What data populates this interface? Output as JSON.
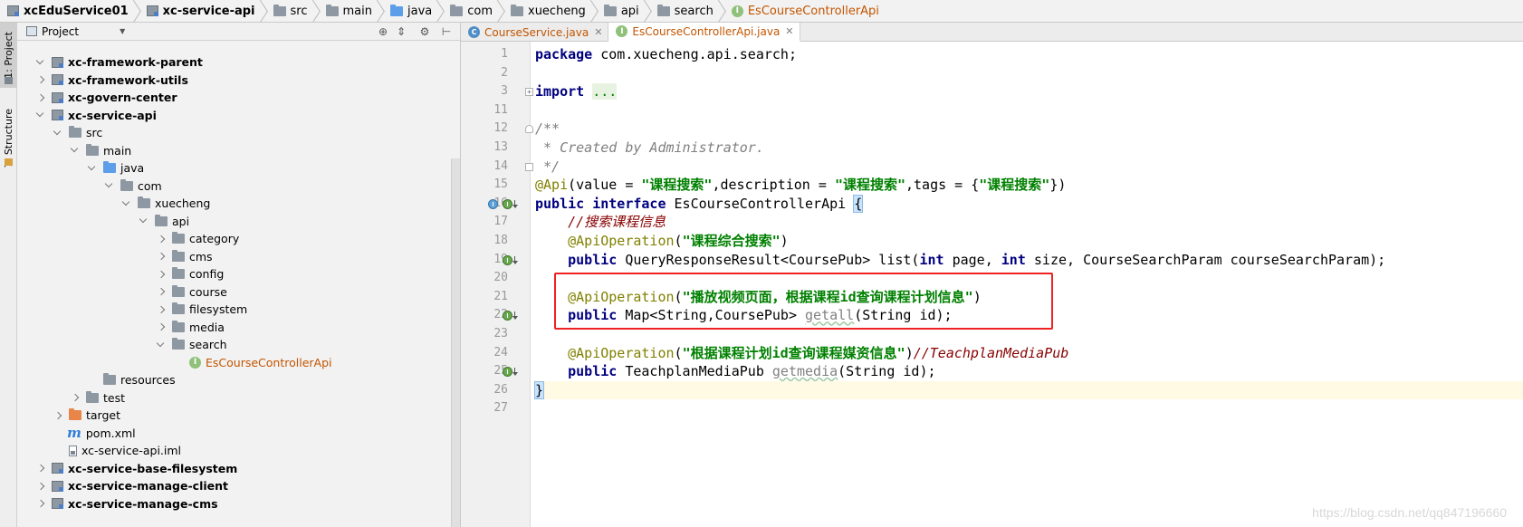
{
  "breadcrumb": {
    "items": [
      {
        "label": "xcEduService01",
        "icon": "module-icon",
        "bold": true
      },
      {
        "label": "xc-service-api",
        "icon": "module-icon",
        "bold": true
      },
      {
        "label": "src",
        "icon": "folder-icon"
      },
      {
        "label": "main",
        "icon": "folder-icon"
      },
      {
        "label": "java",
        "icon": "source-folder-icon"
      },
      {
        "label": "com",
        "icon": "package-icon"
      },
      {
        "label": "xuecheng",
        "icon": "package-icon"
      },
      {
        "label": "api",
        "icon": "package-icon"
      },
      {
        "label": "search",
        "icon": "package-icon"
      },
      {
        "label": "EsCourseControllerApi",
        "icon": "interface-icon"
      }
    ]
  },
  "tool_strip": {
    "project_tab": "1: Project",
    "structure_tab": "7: Structure"
  },
  "project_panel": {
    "title": "Project",
    "tree": [
      {
        "label": "xc-framework-parent",
        "depth": 1,
        "state": "open",
        "bold": true,
        "icon": "module-icon"
      },
      {
        "label": "xc-framework-utils",
        "depth": 1,
        "state": "closed",
        "bold": true,
        "icon": "module-icon"
      },
      {
        "label": "xc-govern-center",
        "depth": 1,
        "state": "closed",
        "bold": true,
        "icon": "module-icon"
      },
      {
        "label": "xc-service-api",
        "depth": 1,
        "state": "open",
        "bold": true,
        "icon": "module-icon"
      },
      {
        "label": "src",
        "depth": 2,
        "state": "open",
        "icon": "folder-icon"
      },
      {
        "label": "main",
        "depth": 3,
        "state": "open",
        "icon": "folder-icon"
      },
      {
        "label": "java",
        "depth": 4,
        "state": "open",
        "icon": "source-folder-icon"
      },
      {
        "label": "com",
        "depth": 5,
        "state": "open",
        "icon": "package-icon"
      },
      {
        "label": "xuecheng",
        "depth": 6,
        "state": "open",
        "icon": "package-icon"
      },
      {
        "label": "api",
        "depth": 7,
        "state": "open",
        "icon": "package-icon"
      },
      {
        "label": "category",
        "depth": 8,
        "state": "closed",
        "icon": "package-icon"
      },
      {
        "label": "cms",
        "depth": 8,
        "state": "closed",
        "icon": "package-icon"
      },
      {
        "label": "config",
        "depth": 8,
        "state": "closed",
        "icon": "package-icon"
      },
      {
        "label": "course",
        "depth": 8,
        "state": "closed",
        "icon": "package-icon"
      },
      {
        "label": "filesystem",
        "depth": 8,
        "state": "closed",
        "icon": "package-icon"
      },
      {
        "label": "media",
        "depth": 8,
        "state": "closed",
        "icon": "package-icon"
      },
      {
        "label": "search",
        "depth": 8,
        "state": "open",
        "icon": "package-icon"
      },
      {
        "label": "EsCourseControllerApi",
        "depth": 9,
        "state": "none",
        "icon": "interface-icon",
        "class": true
      },
      {
        "label": "resources",
        "depth": 4,
        "state": "none",
        "icon": "resources-folder-icon"
      },
      {
        "label": "test",
        "depth": 3,
        "state": "closed",
        "icon": "folder-icon"
      },
      {
        "label": "target",
        "depth": 2,
        "state": "closed",
        "icon": "excluded-folder-icon"
      },
      {
        "label": "pom.xml",
        "depth": 2,
        "state": "none",
        "icon": "maven-icon"
      },
      {
        "label": "xc-service-api.iml",
        "depth": 2,
        "state": "none",
        "icon": "iml-file-icon"
      },
      {
        "label": "xc-service-base-filesystem",
        "depth": 1,
        "state": "closed",
        "bold": true,
        "icon": "module-icon"
      },
      {
        "label": "xc-service-manage-client",
        "depth": 1,
        "state": "closed",
        "bold": true,
        "icon": "module-icon"
      },
      {
        "label": "xc-service-manage-cms",
        "depth": 1,
        "state": "closed",
        "bold": true,
        "icon": "module-icon"
      }
    ]
  },
  "editor_tabs": [
    {
      "label": "CourseService.java",
      "icon": "class-icon",
      "active": false
    },
    {
      "label": "EsCourseControllerApi.java",
      "icon": "interface-icon",
      "active": true
    }
  ],
  "editor": {
    "line_numbers": [
      "1",
      "2",
      "3",
      "11",
      "12",
      "13",
      "14",
      "15",
      "16",
      "17",
      "18",
      "19",
      "20",
      "21",
      "22",
      "23",
      "24",
      "25",
      "26",
      "27"
    ],
    "lines": [
      [
        {
          "t": "package ",
          "c": "kw"
        },
        {
          "t": "com.xuecheng.api.search;"
        }
      ],
      [],
      [
        {
          "t": "import ",
          "c": "kw"
        },
        {
          "t": "...",
          "c": "fold-text"
        }
      ],
      [],
      [
        {
          "t": "/**",
          "c": "cmt"
        }
      ],
      [
        {
          "t": " * Created by Administrator.",
          "c": "cmt"
        }
      ],
      [
        {
          "t": " */",
          "c": "cmt"
        }
      ],
      [
        {
          "t": "@Api",
          "c": "ann"
        },
        {
          "t": "(value = "
        },
        {
          "t": "\"课程搜索\"",
          "c": "str"
        },
        {
          "t": ",description = "
        },
        {
          "t": "\"课程搜索\"",
          "c": "str"
        },
        {
          "t": ",tags = {"
        },
        {
          "t": "\"课程搜索\"",
          "c": "str"
        },
        {
          "t": "})"
        }
      ],
      [
        {
          "t": "public ",
          "c": "kw"
        },
        {
          "t": "interface ",
          "c": "kw"
        },
        {
          "t": "EsCourseControllerApi "
        },
        {
          "t": "{",
          "c": "brace-hl"
        }
      ],
      [
        {
          "t": "    "
        },
        {
          "t": "//搜索课程信息",
          "c": "cmt-red"
        }
      ],
      [
        {
          "t": "    "
        },
        {
          "t": "@ApiOperation",
          "c": "ann"
        },
        {
          "t": "("
        },
        {
          "t": "\"课程综合搜索\"",
          "c": "str"
        },
        {
          "t": ")"
        }
      ],
      [
        {
          "t": "    "
        },
        {
          "t": "public ",
          "c": "kw"
        },
        {
          "t": "QueryResponseResult<CoursePub> list("
        },
        {
          "t": "int ",
          "c": "kw"
        },
        {
          "t": "page, "
        },
        {
          "t": "int ",
          "c": "kw"
        },
        {
          "t": "size, CourseSearchParam courseSearchParam);"
        }
      ],
      [],
      [
        {
          "t": "    "
        },
        {
          "t": "@ApiOperation",
          "c": "ann"
        },
        {
          "t": "("
        },
        {
          "t": "\"播放视频页面，根据课程id查询课程计划信息\"",
          "c": "str"
        },
        {
          "t": ")"
        }
      ],
      [
        {
          "t": "    "
        },
        {
          "t": "public ",
          "c": "kw"
        },
        {
          "t": "Map<String,CoursePub> "
        },
        {
          "t": "getall",
          "c": "unused squiggle"
        },
        {
          "t": "(String id);"
        }
      ],
      [],
      [
        {
          "t": "    "
        },
        {
          "t": "@ApiOperation",
          "c": "ann"
        },
        {
          "t": "("
        },
        {
          "t": "\"根据课程计划id查询课程媒资信息\"",
          "c": "str"
        },
        {
          "t": ")"
        },
        {
          "t": "//TeachplanMediaPub",
          "c": "cmt-red"
        }
      ],
      [
        {
          "t": "    "
        },
        {
          "t": "public ",
          "c": "kw"
        },
        {
          "t": "TeachplanMediaPub "
        },
        {
          "t": "getmedia",
          "c": "unused squiggle"
        },
        {
          "t": "(String id);"
        }
      ],
      [
        {
          "t": "}",
          "c": "brace-hl"
        }
      ],
      []
    ],
    "current_line_index": 18
  },
  "watermark": "https://blog.csdn.net/qq847196660",
  "colors": {
    "keyword": "#000080",
    "string": "#008000",
    "annotation": "#808000",
    "comment": "#808080",
    "class_name": "#c35500",
    "highlight_box": "#ee2222"
  }
}
